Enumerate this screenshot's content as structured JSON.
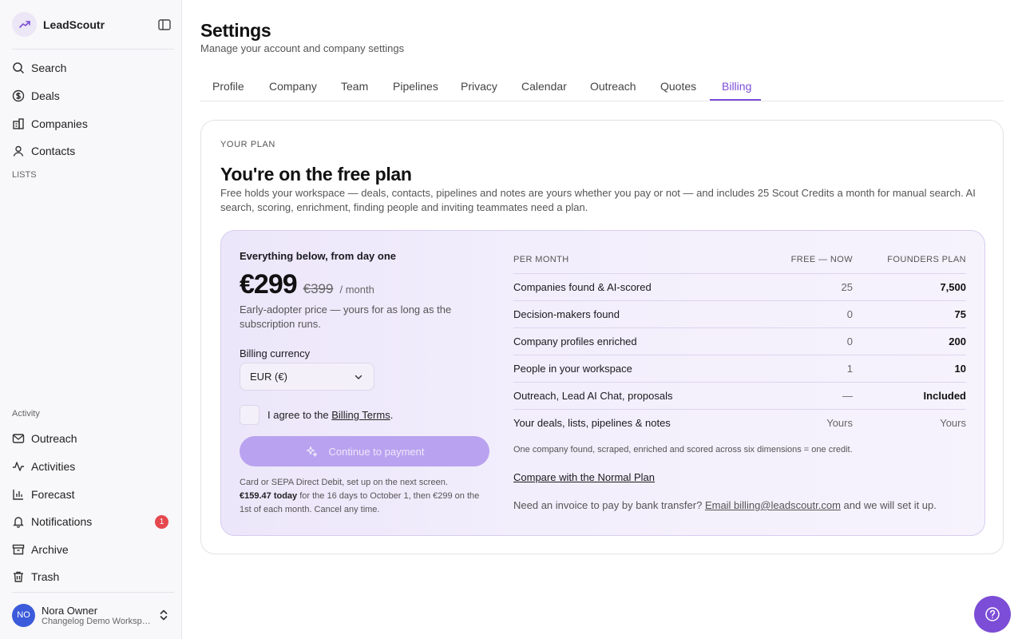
{
  "app": {
    "name": "LeadScoutr"
  },
  "sidebar": {
    "nav": [
      "Search",
      "Deals",
      "Companies",
      "Contacts"
    ],
    "lists_label": "LISTS",
    "activity_label": "Activity",
    "activity": [
      "Outreach",
      "Activities",
      "Forecast",
      "Notifications",
      "Archive",
      "Trash"
    ],
    "notifications_count": "1",
    "user": {
      "initials": "NO",
      "name": "Nora Owner",
      "workspace": "Changelog Demo Workspace"
    }
  },
  "header": {
    "title": "Settings",
    "subtitle": "Manage your account and company settings"
  },
  "tabs": [
    "Profile",
    "Company",
    "Team",
    "Pipelines",
    "Privacy",
    "Calendar",
    "Outreach",
    "Quotes",
    "Billing"
  ],
  "active_tab": "Billing",
  "plan": {
    "label": "YOUR PLAN",
    "title": "You're on the free plan",
    "description": "Free holds your workspace — deals, contacts, pipelines and notes are yours whether you pay or not — and includes 25 Scout Credits a month for manual search. AI search, scoring, enrichment, finding people and inviting teammates need a plan."
  },
  "offer": {
    "lead": "Everything below, from day one",
    "price": "€299",
    "old_price": "€399",
    "per": "/ month",
    "price_note": "Early-adopter price — yours for as long as the subscription runs.",
    "currency_label": "Billing currency",
    "currency_value": "EUR (€)",
    "agree_prefix": "I agree to the",
    "agree_link": "Billing Terms",
    "agree_suffix": ".",
    "pay_button": "Continue to payment",
    "fine_line1": "Card or SEPA Direct Debit, set up on the next screen.",
    "fine_bold": "€159.47 today",
    "fine_line2": " for the 16 days to October 1, then €299 on the 1st of each month. Cancel any time."
  },
  "comparison": {
    "headers": [
      "PER MONTH",
      "FREE — NOW",
      "FOUNDERS PLAN"
    ],
    "rows": [
      {
        "label": "Companies found & AI-scored",
        "free": "25",
        "founders": "7,500"
      },
      {
        "label": "Decision-makers found",
        "free": "0",
        "founders": "75"
      },
      {
        "label": "Company profiles enriched",
        "free": "0",
        "founders": "200"
      },
      {
        "label": "People in your workspace",
        "free": "1",
        "founders": "10"
      },
      {
        "label": "Outreach, Lead AI Chat, proposals",
        "free": "—",
        "founders": "Included"
      },
      {
        "label": "Your deals, lists, pipelines & notes",
        "free": "Yours",
        "founders": "Yours"
      }
    ],
    "credit_note": "One company found, scraped, enriched and scored across six dimensions = one credit.",
    "compare_link": "Compare with the Normal Plan",
    "invoice_prefix": "Need an invoice to pay by bank transfer?",
    "invoice_link": "Email billing@leadscoutr.com",
    "invoice_suffix": " and we will set it up."
  },
  "colors": {
    "accent": "#7c4dd6",
    "button_disabled": "#b9a2ef",
    "badge": "#e5484d",
    "avatar": "#3b5bdb"
  },
  "icons": [
    "trend-up-icon",
    "sidebar-toggle-icon",
    "search-icon",
    "dollar-icon",
    "building-icon",
    "user-icon",
    "mail-icon",
    "activity-icon",
    "bar-chart-icon",
    "bell-icon",
    "archive-icon",
    "trash-icon",
    "chevron-up-down-icon",
    "chevron-down-icon",
    "sparkle-icon",
    "help-icon"
  ]
}
